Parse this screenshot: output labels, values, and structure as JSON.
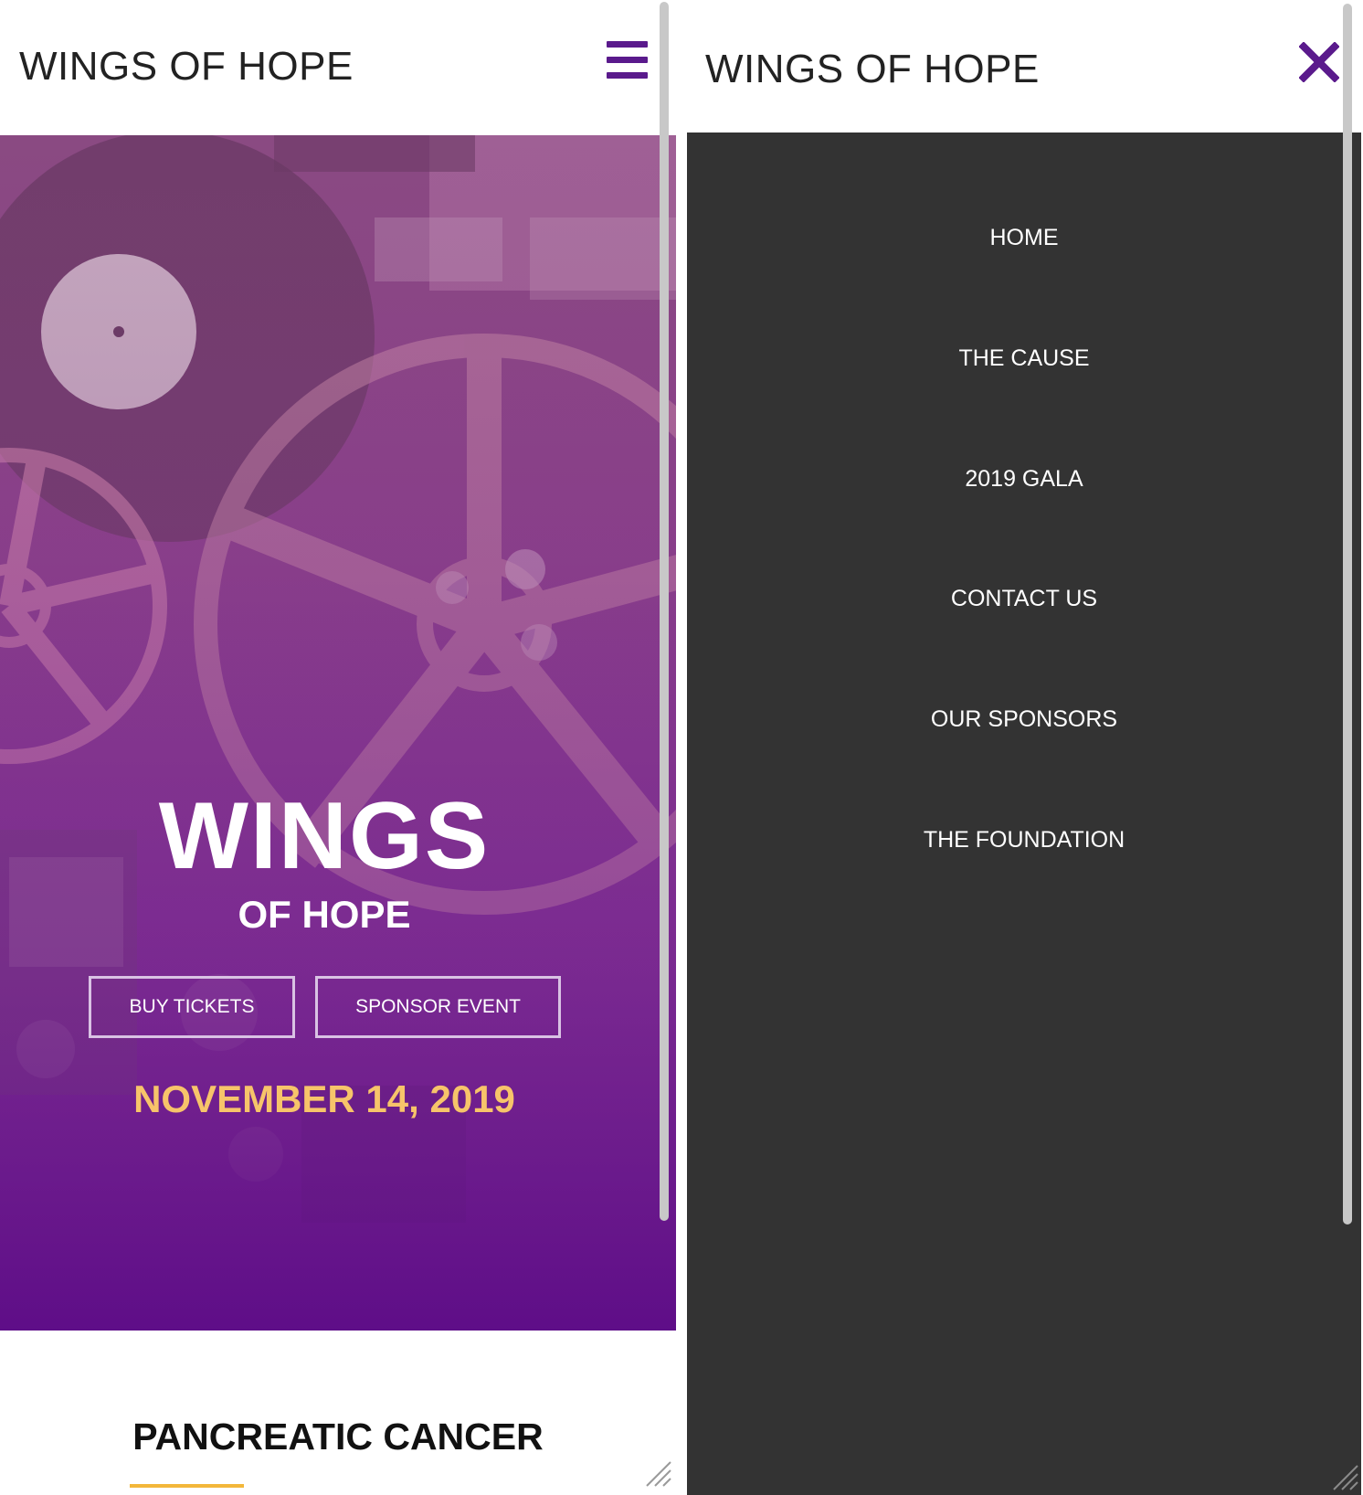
{
  "left_screen": {
    "header": {
      "title": "WINGS OF HOPE",
      "menu_icon": "hamburger-menu-icon"
    },
    "hero": {
      "headline": "WINGS",
      "subheadline": "OF HOPE",
      "buttons": {
        "buy_tickets": "BUY TICKETS",
        "sponsor_event": "SPONSOR EVENT"
      },
      "date": "NOVEMBER 14, 2019",
      "background_image": "film-reels-photo"
    },
    "section": {
      "heading": "PANCREATIC CANCER"
    }
  },
  "right_screen": {
    "header": {
      "title": "WINGS OF HOPE",
      "close_icon": "close-icon"
    },
    "menu": {
      "items": [
        {
          "label": "HOME"
        },
        {
          "label": "THE CAUSE"
        },
        {
          "label": "2019 GALA"
        },
        {
          "label": "CONTACT US"
        },
        {
          "label": "OUR SPONSORS"
        },
        {
          "label": "THE FOUNDATION"
        }
      ]
    }
  },
  "colors": {
    "brand_purple": "#5a1a8c",
    "menu_background": "#333333",
    "date_gold": "#f7c46a",
    "underline_gold": "#f3b73a",
    "title_text": "#222222"
  }
}
